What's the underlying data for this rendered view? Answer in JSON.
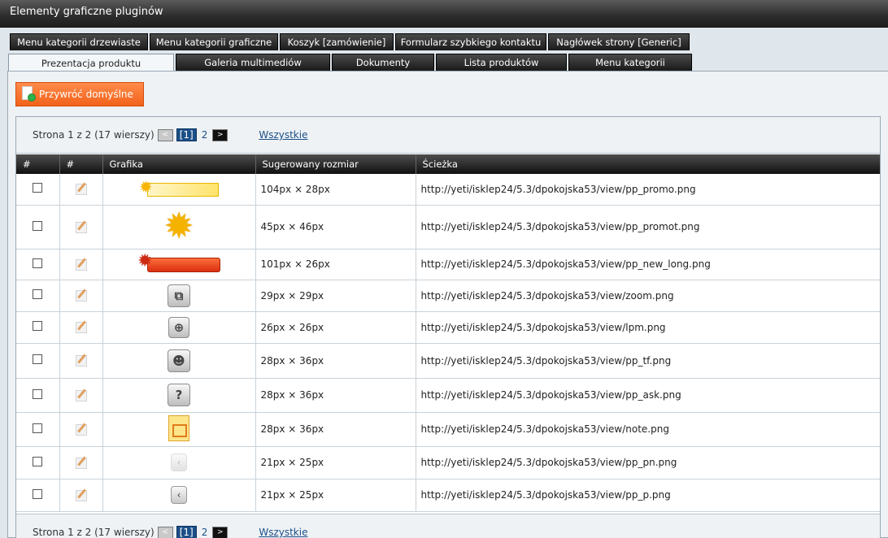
{
  "window": {
    "title": "Elementy graficzne pluginów"
  },
  "tabs_row1": [
    {
      "label": "Menu kategorii drzewiaste"
    },
    {
      "label": "Menu kategorii graficzne"
    },
    {
      "label": "Koszyk [zamówienie]"
    },
    {
      "label": "Formularz szybkiego kontaktu"
    },
    {
      "label": "Nagłówek strony [Generic]"
    }
  ],
  "tabs_row2": [
    {
      "label": "Prezentacja produktu",
      "active": true
    },
    {
      "label": "Galeria multimediów"
    },
    {
      "label": "Dokumenty"
    },
    {
      "label": "Lista produktów"
    },
    {
      "label": "Menu kategorii"
    }
  ],
  "toolbar": {
    "restore_label": "Przywróć domyślne"
  },
  "pager": {
    "info": "Strona 1 z 2 (17 wierszy)",
    "prev": "<",
    "current": "[1]",
    "page2": "2",
    "next": ">",
    "all": "Wszystkie"
  },
  "table": {
    "headers": [
      "#",
      "#",
      "Grafika",
      "Sugerowany rozmiar",
      "Ścieżka"
    ],
    "rows": [
      {
        "icon": "promo-banner-icon",
        "size": "104px × 28px",
        "path": "http://yeti/isklep24/5.3/dpokojska53/view/pp_promo.png"
      },
      {
        "icon": "promo-star-icon",
        "size": "45px × 46px",
        "path": "http://yeti/isklep24/5.3/dpokojska53/view/pp_promot.png"
      },
      {
        "icon": "new-long-banner-icon",
        "size": "101px × 26px",
        "path": "http://yeti/isklep24/5.3/dpokojska53/view/pp_new_long.png"
      },
      {
        "icon": "zoom-icon",
        "size": "29px × 29px",
        "path": "http://yeti/isklep24/5.3/dpokojska53/view/zoom.png"
      },
      {
        "icon": "magnifier-icon",
        "size": "26px × 26px",
        "path": "http://yeti/isklep24/5.3/dpokojska53/view/lpm.png"
      },
      {
        "icon": "tell-friend-icon",
        "size": "28px × 36px",
        "path": "http://yeti/isklep24/5.3/dpokojska53/view/pp_tf.png"
      },
      {
        "icon": "question-icon",
        "size": "28px × 36px",
        "path": "http://yeti/isklep24/5.3/dpokojska53/view/pp_ask.png"
      },
      {
        "icon": "note-icon",
        "size": "28px × 36px",
        "path": "http://yeti/isklep24/5.3/dpokojska53/view/note.png"
      },
      {
        "icon": "prev-next-icon",
        "size": "21px × 25px",
        "path": "http://yeti/isklep24/5.3/dpokojska53/view/pp_pn.png"
      },
      {
        "icon": "prev-icon",
        "size": "21px × 25px",
        "path": "http://yeti/isklep24/5.3/dpokojska53/view/pp_p.png"
      }
    ]
  },
  "colors": {
    "accent_button": "#f2621b",
    "link": "#1c4f87",
    "header_dark": "#101010"
  }
}
